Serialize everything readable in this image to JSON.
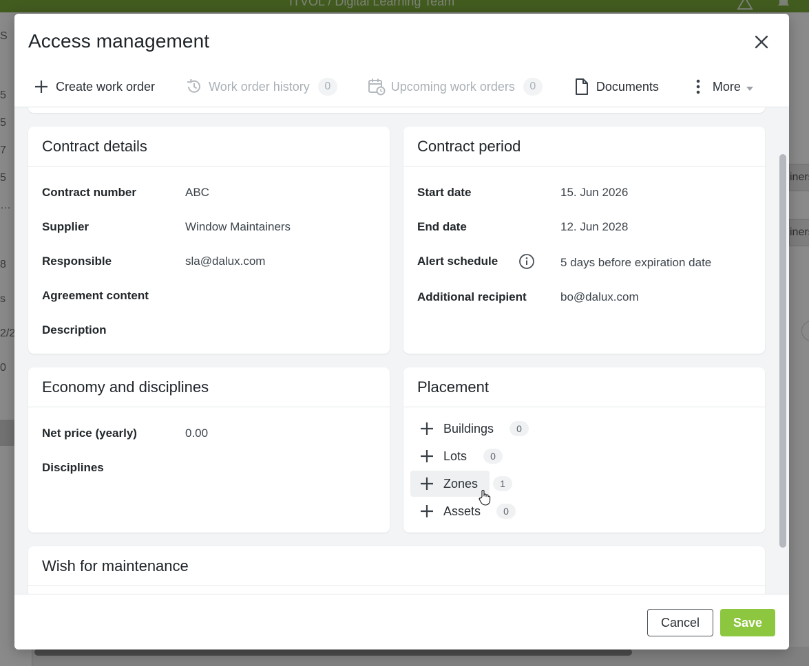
{
  "background": {
    "topbar_title": "ITVOL / Digital Learning Team",
    "right_chip_text": "iners"
  },
  "modal": {
    "title": "Access management",
    "toolbar": {
      "create_work_order": "Create work order",
      "work_order_history": "Work order history",
      "work_order_history_count": "0",
      "upcoming_work_orders": "Upcoming work orders",
      "upcoming_work_orders_count": "0",
      "documents": "Documents",
      "more": "More"
    },
    "contract_details": {
      "title": "Contract details",
      "fields": [
        {
          "label": "Contract number",
          "value": "ABC"
        },
        {
          "label": "Supplier",
          "value": "Window Maintainers"
        },
        {
          "label": "Responsible",
          "value": "sla@dalux.com"
        },
        {
          "label": "Agreement content",
          "value": ""
        },
        {
          "label": "Description",
          "value": ""
        }
      ]
    },
    "contract_period": {
      "title": "Contract period",
      "fields": [
        {
          "label": "Start date",
          "value": "15. Jun 2026"
        },
        {
          "label": "End date",
          "value": "12. Jun 2028"
        },
        {
          "label": "Alert schedule",
          "value": "5 days before expiration date"
        },
        {
          "label": "Additional recipient",
          "value": "bo@dalux.com"
        }
      ]
    },
    "economy": {
      "title": "Economy and disciplines",
      "fields": [
        {
          "label": "Net price (yearly)",
          "value": "0.00"
        },
        {
          "label": "Disciplines",
          "value": ""
        }
      ]
    },
    "placement": {
      "title": "Placement",
      "items": [
        {
          "label": "Buildings",
          "count": "0"
        },
        {
          "label": "Lots",
          "count": "0"
        },
        {
          "label": "Zones",
          "count": "1"
        },
        {
          "label": "Assets",
          "count": "0"
        }
      ]
    },
    "wish": {
      "title": "Wish for maintenance"
    },
    "footer": {
      "cancel": "Cancel",
      "save": "Save"
    }
  },
  "colors": {
    "accent_green": "#8dc63f",
    "topbar_green": "#7aa83a"
  }
}
